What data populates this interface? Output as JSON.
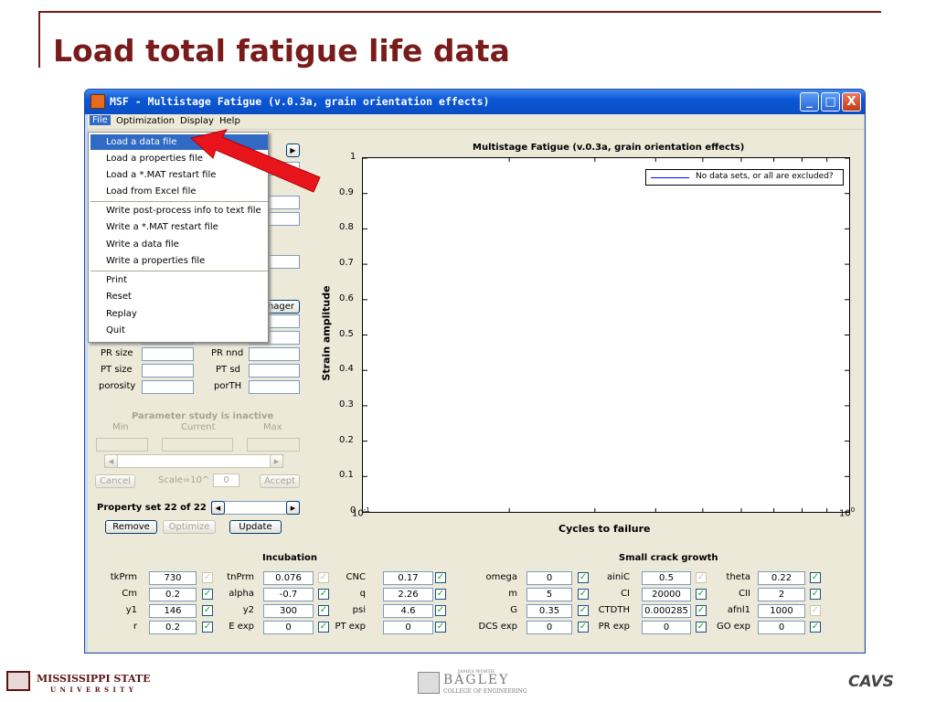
{
  "slide": {
    "title": "Load total fatigue life data",
    "footer_left": "MISSISSIPPI STATE",
    "footer_left_sub": "U N I V E R S I T Y",
    "footer_mid": "BAGLEY",
    "footer_mid_top": "JAMES WORTH",
    "footer_mid_sub": "COLLEGE OF ENGINEERING",
    "footer_right": "CAVS"
  },
  "window": {
    "title": "MSF - Multistage Fatigue (v.0.3a, grain orientation effects)",
    "minimize": "_",
    "maximize": "□",
    "close": "X"
  },
  "menubar": [
    "File",
    "Optimization",
    "Display",
    "Help"
  ],
  "file_menu": {
    "group1": [
      "Load a data file",
      "Load a properties file",
      "Load a *.MAT restart file",
      "Load from Excel file"
    ],
    "group2": [
      "Write post-process info to text file",
      "Write a *.MAT restart file",
      "Write a data file",
      "Write a properties file"
    ],
    "group3": [
      "Print",
      "Reset",
      "Replay",
      "Quit"
    ]
  },
  "left_panel": {
    "manager_button": "nager",
    "rows": [
      {
        "l1": "PR size",
        "l2": "PR nnd"
      },
      {
        "l1": "PT size",
        "l2": "PT sd"
      },
      {
        "l1": "porosity",
        "l2": "porTH"
      }
    ],
    "param_study": {
      "title": "Parameter study is inactive",
      "min": "Min",
      "current": "Current",
      "max": "Max"
    },
    "cancel": "Cancel",
    "scale_label": "Scale=10^",
    "scale_value": "0",
    "accept": "Accept",
    "property_set": "Property set 22 of 22",
    "remove": "Remove",
    "optimize": "Optimize",
    "update": "Update"
  },
  "chart_data": {
    "type": "line",
    "title": "Multistage Fatigue (v.0.3a, grain orientation effects)",
    "xlabel": "Cycles to failure",
    "ylabel": "Strain amplitude",
    "x_scale": "log",
    "xlim": [
      0.1,
      1
    ],
    "x_ticks": [
      "10",
      "10"
    ],
    "x_tick_exps": [
      "-1",
      "0"
    ],
    "ylim": [
      0,
      1
    ],
    "y_ticks": [
      "0",
      "0.1",
      "0.2",
      "0.3",
      "0.4",
      "0.5",
      "0.6",
      "0.7",
      "0.8",
      "0.9",
      "1"
    ],
    "legend": {
      "text": "No data sets, or all are excluded?",
      "position": "top-right",
      "color": "#0000ff"
    },
    "series": []
  },
  "incubation": {
    "title": "Incubation",
    "rows": [
      {
        "l1": "tkPrm",
        "v1": "730",
        "c1": "off",
        "l2": "tnPrm",
        "v2": "0.076",
        "c2": "off",
        "l3": "CNC",
        "v3": "0.17",
        "c3": "on"
      },
      {
        "l1": "Cm",
        "v1": "0.2",
        "c1": "on",
        "l2": "alpha",
        "v2": "-0.7",
        "c2": "on",
        "l3": "q",
        "v3": "2.26",
        "c3": "on"
      },
      {
        "l1": "y1",
        "v1": "146",
        "c1": "on",
        "l2": "y2",
        "v2": "300",
        "c2": "on",
        "l3": "psi",
        "v3": "4.6",
        "c3": "on"
      },
      {
        "l1": "r",
        "v1": "0.2",
        "c1": "on",
        "l2": "E exp",
        "v2": "0",
        "c2": "on",
        "l3": "PT exp",
        "v3": "0",
        "c3": "on"
      }
    ]
  },
  "small_crack": {
    "title": "Small crack growth",
    "rows": [
      {
        "l1": "omega",
        "v1": "0",
        "c1": "on",
        "l2": "ainiC",
        "v2": "0.5",
        "c2": "off",
        "l3": "theta",
        "v3": "0.22",
        "c3": "on"
      },
      {
        "l1": "m",
        "v1": "5",
        "c1": "on",
        "l2": "CI",
        "v2": "20000",
        "c2": "on",
        "l3": "CII",
        "v3": "2",
        "c3": "on"
      },
      {
        "l1": "G",
        "v1": "0.35",
        "c1": "on",
        "l2": "CTDTH",
        "v2": "0.000285",
        "c2": "on",
        "l3": "afnl1",
        "v3": "1000",
        "c3": "off"
      },
      {
        "l1": "DCS exp",
        "v1": "0",
        "c1": "on",
        "l2": "PR exp",
        "v2": "0",
        "c2": "on",
        "l3": "GO exp",
        "v3": "0",
        "c3": "on"
      }
    ]
  },
  "colors": {
    "title_red": "#7a1b1b",
    "arrow": "#e8141c",
    "selected": "#316ac5"
  }
}
